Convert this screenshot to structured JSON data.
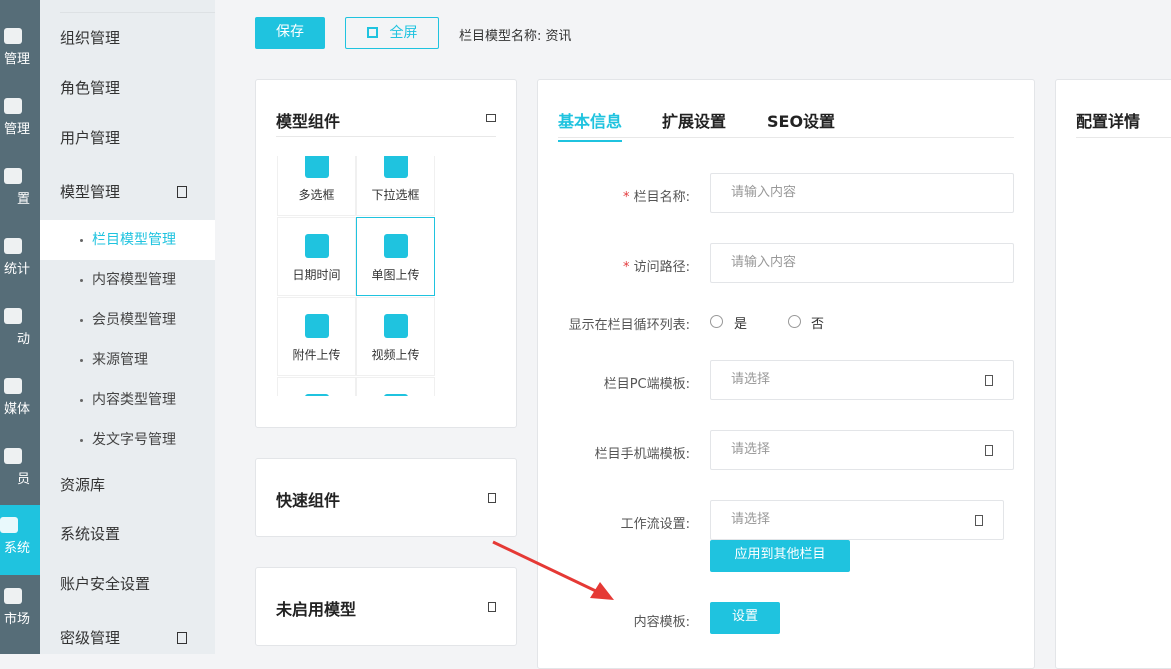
{
  "rail": [
    "管理",
    "管理",
    "置",
    "统计",
    "动",
    "媒体",
    "员",
    "系统",
    "市场"
  ],
  "sidebar": {
    "items": [
      "组织管理",
      "角色管理",
      "用户管理",
      "模型管理"
    ],
    "sub": [
      "栏目模型管理",
      "内容模型管理",
      "会员模型管理",
      "来源管理",
      "内容类型管理",
      "发文字号管理"
    ],
    "bottom": [
      "资源库",
      "系统设置",
      "账户安全设置",
      "密级管理"
    ]
  },
  "toolbar": {
    "save": "保存",
    "fullscreen": "全屏",
    "model_label": "栏目模型名称:",
    "model_name": "资讯"
  },
  "components": {
    "title": "模型组件",
    "items": [
      "多选框",
      "下拉选框",
      "日期时间",
      "单图上传",
      "附件上传",
      "视频上传"
    ]
  },
  "quick": {
    "title": "快速组件"
  },
  "unused": {
    "title": "未启用模型"
  },
  "tabs": [
    "基本信息",
    "扩展设置",
    "SEO设置"
  ],
  "form": {
    "name_label": "栏目名称:",
    "name_placeholder": "请输入内容",
    "path_label": "访问路径:",
    "path_placeholder": "请输入内容",
    "show_label": "显示在栏目循环列表:",
    "yes": "是",
    "no": "否",
    "pc_label": "栏目PC端模板:",
    "pc_placeholder": "请选择",
    "mobile_label": "栏目手机端模板:",
    "mobile_placeholder": "请选择",
    "workflow_label": "工作流设置:",
    "workflow_placeholder": "请选择",
    "apply_button": "应用到其他栏目",
    "content_label": "内容模板:",
    "content_button": "设置"
  },
  "config": {
    "title": "配置详情"
  },
  "colors": {
    "primary": "#1fc3df",
    "rail": "#566d78",
    "arrow": "#e53935"
  }
}
